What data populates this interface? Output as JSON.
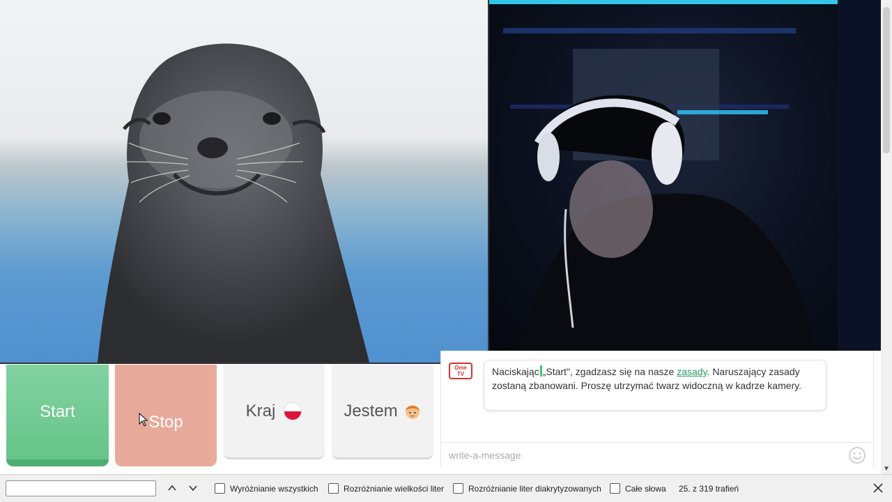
{
  "controls": {
    "start_label": "Start",
    "stop_label": "Stop",
    "country_label": "Kraj",
    "country_flag_icon": "poland-flag-icon",
    "gender_label": "Jestem",
    "gender_icon": "boy-emoji-icon"
  },
  "chat": {
    "logo_text_top": "Ome",
    "logo_text_bottom": "TV",
    "system_message": {
      "part1": "Naciskając",
      "part2": "„Start\", zgadzasz się na nasze ",
      "link": "zasady",
      "part3": ". Naruszający zasady zostaną zbanowani. Proszę utrzymać twarz widoczną w kadrze kamery."
    },
    "input_placeholder": "write-a-message"
  },
  "findbar": {
    "search_value": "",
    "highlight_all": "Wyróżnianie wszystkich",
    "match_case": "Rozróżnianie wielkości liter",
    "match_diacritics": "Rozróżnianie liter diakrytyzowanych",
    "whole_words": "Całe słowa",
    "status": "25. z 319 trafień"
  },
  "colors": {
    "start": "#66c48a",
    "stop": "#e8aa9b",
    "link": "#2a9d5c",
    "highlight": "#3ec86c"
  }
}
